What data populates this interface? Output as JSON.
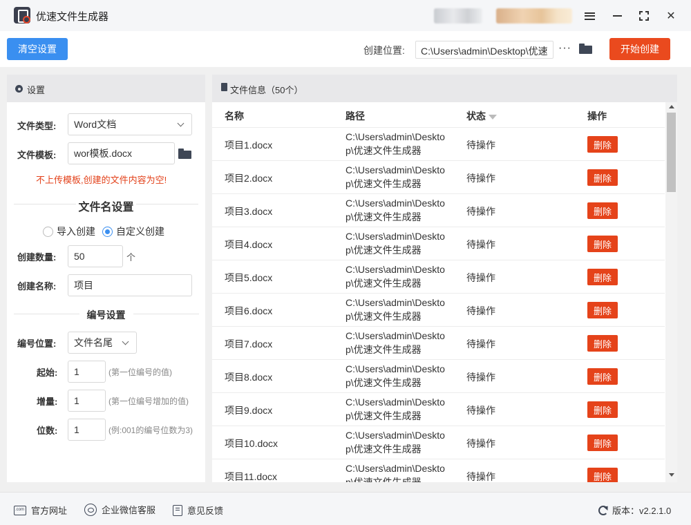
{
  "app": {
    "title": "优速文件生成器"
  },
  "toolbar": {
    "clear_label": "清空设置",
    "location_label": "创建位置:",
    "location_value": "C:\\Users\\admin\\Desktop\\优速",
    "more_label": "···",
    "start_label": "开始创建"
  },
  "settings": {
    "title": "设置",
    "file_type_label": "文件类型:",
    "file_type_value": "Word文档",
    "template_label": "文件模板:",
    "template_value": "wor模板.docx",
    "warning": "不上传模板,创建的文件内容为空!",
    "filename_section": "文件名设置",
    "radio_import": "导入创建",
    "radio_custom": "自定义创建",
    "radio_selected": "自定义创建",
    "count_label": "创建数量:",
    "count_value": "50",
    "count_unit": "个",
    "name_label": "创建名称:",
    "name_value": "项目",
    "numbering_section": "编号设置",
    "position_label": "编号位置:",
    "position_value": "文件名尾",
    "start_label": "起始:",
    "start_value": "1",
    "start_hint": "(第一位编号的值)",
    "step_label": "增量:",
    "step_value": "1",
    "step_hint": "(第一位编号增加的值)",
    "digits_label": "位数:",
    "digits_value": "1",
    "digits_hint": "(例:001的编号位数为3)"
  },
  "files": {
    "title": "文件信息（50个）",
    "columns": {
      "name": "名称",
      "path": "路径",
      "status": "状态",
      "action": "操作"
    },
    "rows": [
      {
        "name": "项目1.docx",
        "path": "C:\\Users\\admin\\Desktop\\优速文件生成器",
        "status": "待操作",
        "action": "删除"
      },
      {
        "name": "项目2.docx",
        "path": "C:\\Users\\admin\\Desktop\\优速文件生成器",
        "status": "待操作",
        "action": "删除"
      },
      {
        "name": "项目3.docx",
        "path": "C:\\Users\\admin\\Desktop\\优速文件生成器",
        "status": "待操作",
        "action": "删除"
      },
      {
        "name": "项目4.docx",
        "path": "C:\\Users\\admin\\Desktop\\优速文件生成器",
        "status": "待操作",
        "action": "删除"
      },
      {
        "name": "项目5.docx",
        "path": "C:\\Users\\admin\\Desktop\\优速文件生成器",
        "status": "待操作",
        "action": "删除"
      },
      {
        "name": "项目6.docx",
        "path": "C:\\Users\\admin\\Desktop\\优速文件生成器",
        "status": "待操作",
        "action": "删除"
      },
      {
        "name": "项目7.docx",
        "path": "C:\\Users\\admin\\Desktop\\优速文件生成器",
        "status": "待操作",
        "action": "删除"
      },
      {
        "name": "项目8.docx",
        "path": "C:\\Users\\admin\\Desktop\\优速文件生成器",
        "status": "待操作",
        "action": "删除"
      },
      {
        "name": "项目9.docx",
        "path": "C:\\Users\\admin\\Desktop\\优速文件生成器",
        "status": "待操作",
        "action": "删除"
      },
      {
        "name": "项目10.docx",
        "path": "C:\\Users\\admin\\Desktop\\优速文件生成器",
        "status": "待操作",
        "action": "删除"
      },
      {
        "name": "项目11.docx",
        "path": "C:\\Users\\admin\\Desktop\\优速文件生成器",
        "status": "待操作",
        "action": "删除"
      }
    ]
  },
  "footer": {
    "website": "官方网址",
    "wechat": "企业微信客服",
    "feedback": "意见反馈",
    "version": "版本：v2.2.1.0"
  },
  "colors": {
    "primary": "#3a8ff0",
    "danger": "#ea4a1e",
    "warning_text": "#e3421b"
  },
  "icons": [
    "app-logo-icon",
    "menu-icon",
    "minimize-icon",
    "maximize-icon",
    "close-icon",
    "folder-icon",
    "gear-icon",
    "document-icon",
    "filter-icon",
    "website-icon",
    "chat-icon",
    "feedback-icon",
    "refresh-icon"
  ]
}
